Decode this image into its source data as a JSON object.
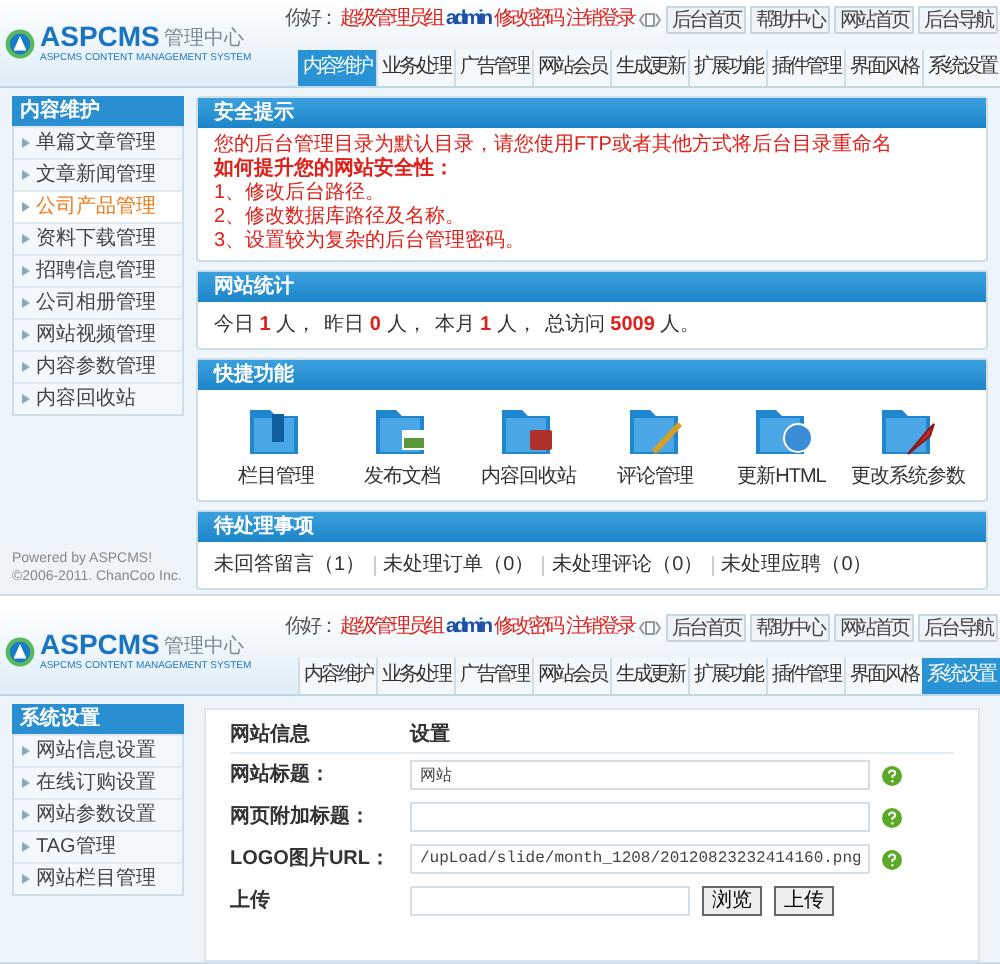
{
  "screens": [
    {
      "header": {
        "logo_title": "ASPCMS",
        "logo_title_cn": "管理中心",
        "logo_tagline": "ASPCMS CONTENT MANAGEMENT SYSTEM",
        "greeting": "你好：",
        "role": "超级管理员组",
        "user": "admin",
        "links": [
          "修改密码",
          "注销登录"
        ],
        "top_buttons": [
          "后台首页",
          "帮助中心",
          "网站首页",
          "后台导航"
        ],
        "tabs": [
          {
            "label": "内容维护",
            "selected": true
          },
          {
            "label": "业务处理",
            "selected": false
          },
          {
            "label": "广告管理",
            "selected": false
          },
          {
            "label": "网站会员",
            "selected": false
          },
          {
            "label": "生成更新",
            "selected": false
          },
          {
            "label": "扩展功能",
            "selected": false
          },
          {
            "label": "插件管理",
            "selected": false
          },
          {
            "label": "界面风格",
            "selected": false
          },
          {
            "label": "系统设置",
            "selected": false
          }
        ]
      },
      "sidebar": {
        "title": "内容维护",
        "items": [
          {
            "label": "单篇文章管理",
            "selected": false
          },
          {
            "label": "文章新闻管理",
            "selected": false
          },
          {
            "label": "公司产品管理",
            "selected": true
          },
          {
            "label": "资料下载管理",
            "selected": false
          },
          {
            "label": "招聘信息管理",
            "selected": false
          },
          {
            "label": "公司相册管理",
            "selected": false
          },
          {
            "label": "网站视频管理",
            "selected": false
          },
          {
            "label": "内容参数管理",
            "selected": false
          },
          {
            "label": "内容回收站",
            "selected": false
          }
        ],
        "footer": [
          "Powered by ASPCMS!",
          "©2006-2011. ChanCoo Inc."
        ]
      },
      "panels": [
        {
          "kind": "notice",
          "title": "安全提示",
          "warning": "您的后台管理目录为默认目录，请您使用FTP或者其他方式将后台目录重命名",
          "heading": "如何提升您的网站安全性：",
          "steps": [
            "1、修改后台路径。",
            "2、修改数据库路径及名称。",
            "3、设置较为复杂的后台管理密码。"
          ]
        },
        {
          "kind": "stats",
          "title": "网站统计",
          "stats": [
            {
              "label": "今日",
              "value": "1",
              "unit": "人，"
            },
            {
              "label": "昨日",
              "value": "0",
              "unit": "人，"
            },
            {
              "label": "本月",
              "value": "1",
              "unit": "人，"
            },
            {
              "label": "总访问",
              "value": "5009",
              "unit": "人。"
            }
          ]
        },
        {
          "kind": "shortcuts",
          "title": "快捷功能",
          "items": [
            {
              "label": "栏目管理",
              "kind": "folder"
            },
            {
              "label": "发布文档",
              "kind": "picture"
            },
            {
              "label": "内容回收站",
              "kind": "trash"
            },
            {
              "label": "评论管理",
              "kind": "pencil"
            },
            {
              "label": "更新HTML",
              "kind": "globe"
            },
            {
              "label": "更改系统参数",
              "kind": "wrench"
            }
          ]
        },
        {
          "kind": "pending",
          "title": "待处理事项",
          "items": [
            "未回答留言（1）",
            "未处理订单（0）",
            "未处理评论（0）",
            "未处理应聘（0）"
          ]
        }
      ]
    },
    {
      "header": {
        "logo_title": "ASPCMS",
        "logo_title_cn": "管理中心",
        "logo_tagline": "ASPCMS CONTENT MANAGEMENT SYSTEM",
        "greeting": "你好：",
        "role": "超级管理员组",
        "user": "admin",
        "links": [
          "修改密码",
          "注销登录"
        ],
        "top_buttons": [
          "后台首页",
          "帮助中心",
          "网站首页",
          "后台导航"
        ],
        "tabs": [
          {
            "label": "内容维护",
            "selected": false
          },
          {
            "label": "业务处理",
            "selected": false
          },
          {
            "label": "广告管理",
            "selected": false
          },
          {
            "label": "网站会员",
            "selected": false
          },
          {
            "label": "生成更新",
            "selected": false
          },
          {
            "label": "扩展功能",
            "selected": false
          },
          {
            "label": "插件管理",
            "selected": false
          },
          {
            "label": "界面风格",
            "selected": false
          },
          {
            "label": "系统设置",
            "selected": true
          }
        ]
      },
      "sidebar": {
        "title": "系统设置",
        "items": [
          {
            "label": "网站信息设置",
            "selected": false
          },
          {
            "label": "在线订购设置",
            "selected": false
          },
          {
            "label": "网站参数设置",
            "selected": false
          },
          {
            "label": "TAG管理",
            "selected": false
          },
          {
            "label": "网站栏目管理",
            "selected": false
          }
        ]
      },
      "form": {
        "columns": [
          "网站信息",
          "设置"
        ],
        "fields": [
          {
            "kind": "text",
            "label": "网站标题：",
            "value": "网站",
            "help": true
          },
          {
            "kind": "text",
            "label": "网页附加标题：",
            "help": true
          },
          {
            "kind": "text",
            "label": "LOGO图片URL：",
            "value": "/upLoad/slide/month_1208/20120823232414160.png",
            "help": true
          },
          {
            "kind": "upload",
            "label": "上传",
            "buttons": [
              "浏览",
              "上传"
            ],
            "help": false
          }
        ]
      }
    }
  ]
}
